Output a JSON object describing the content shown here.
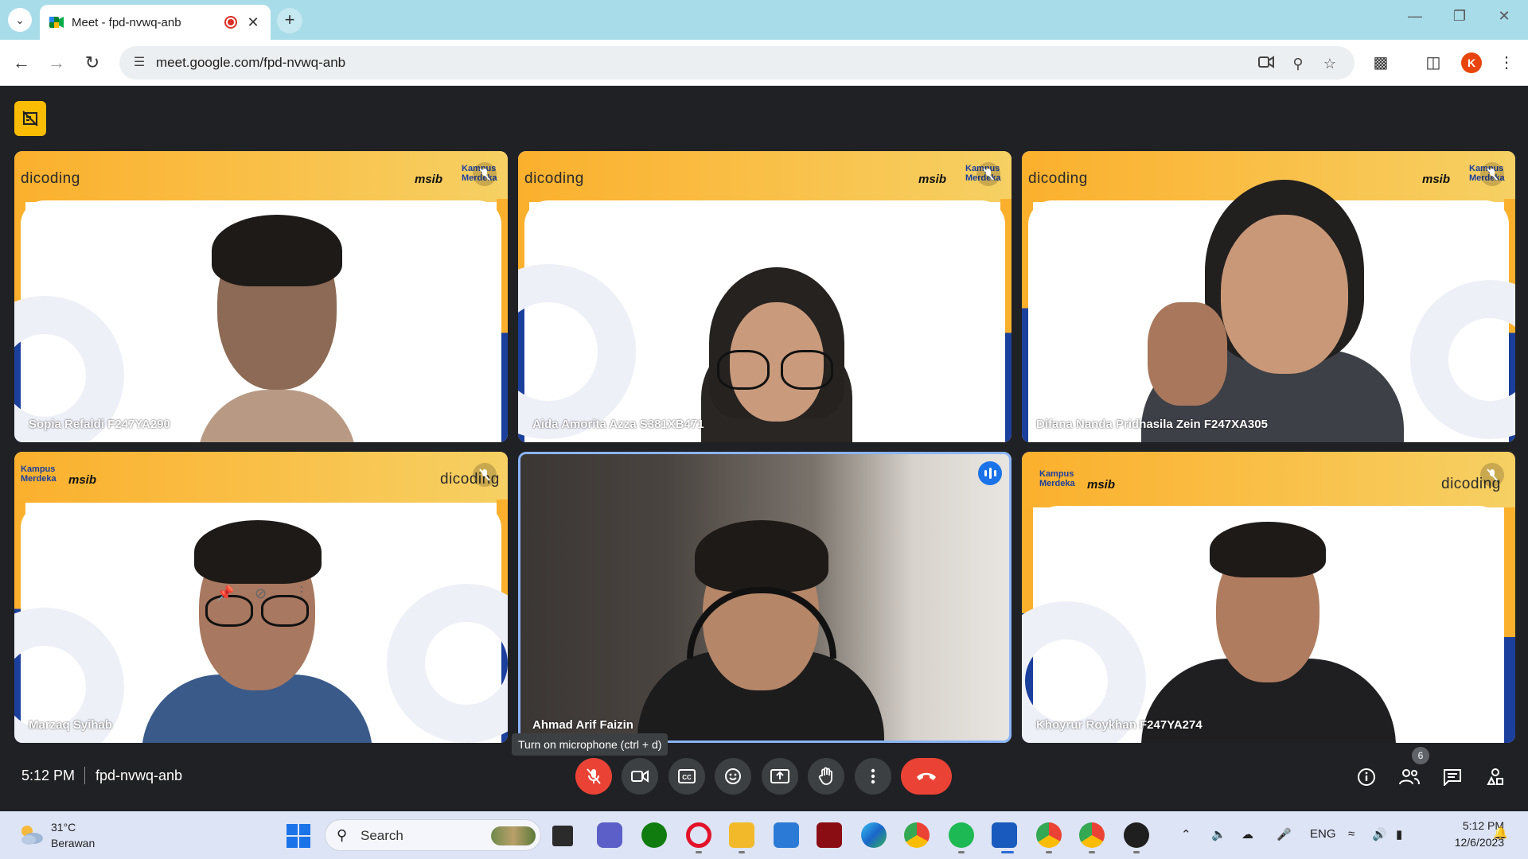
{
  "browser": {
    "tab_title": "Meet - fpd-nvwq-anb",
    "url": "meet.google.com/fpd-nvwq-anb",
    "profile_initial": "K"
  },
  "meeting": {
    "time": "5:12 PM",
    "code": "fpd-nvwq-anb",
    "participant_count": "6",
    "mic_tooltip": "Turn on microphone (ctrl + d)"
  },
  "participants": [
    {
      "name": "Sopia Refaldi F247YA290"
    },
    {
      "name": "Aida Amorita Azza S381XB471"
    },
    {
      "name": "Difana Nanda Pridhasila Zein F247XA305"
    },
    {
      "name": "Marzaq Syihab"
    },
    {
      "name": "Ahmad Arif Faizin"
    },
    {
      "name": "Khoyrur Roykhan F247YA274"
    }
  ],
  "background_logos": {
    "dicoding": "dicoding",
    "msib": "msib",
    "kampus_merdeka": "Kampus Merdeka"
  },
  "controls": {
    "mic": "mic-off-icon",
    "camera": "video-camera-icon",
    "captions": "closed-captions-icon",
    "reactions": "emoji-icon",
    "present": "present-screen-icon",
    "raise_hand": "hand-icon",
    "more": "more-vertical-icon",
    "leave": "end-call-icon"
  },
  "taskbar": {
    "weather_temp": "31°C",
    "weather_desc": "Berawan",
    "search_placeholder": "Search",
    "language": "ENG",
    "clock_time": "5:12 PM",
    "clock_date": "12/6/2023"
  },
  "colors": {
    "meet_bg": "#202124",
    "control_bg": "#3c4043",
    "end_call": "#ea4335",
    "tile_yellow": "#fbb02d",
    "tile_blue": "#1b3f9c",
    "active_border": "#8ab4f8"
  }
}
